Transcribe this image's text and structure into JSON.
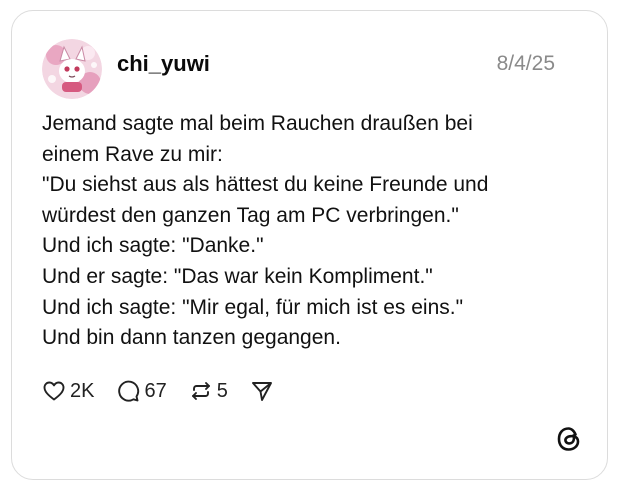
{
  "post": {
    "username": "chi_yuwi",
    "date": "8/4/25",
    "lines": [
      "Jemand sagte mal beim Rauchen draußen bei",
      "einem Rave zu mir:",
      "\"Du siehst aus als hättest du keine Freunde und",
      "würdest den ganzen Tag am PC verbringen.\"",
      "Und ich sagte: \"Danke.\"",
      "Und er sagte: \"Das war kein Kompliment.\"",
      "Und ich sagte: \"Mir egal, für mich ist es eins.\"",
      "Und bin dann tanzen gegangen."
    ],
    "stats": {
      "likes": "2K",
      "replies": "67",
      "reposts": "5"
    }
  },
  "icons": {
    "like": "heart-icon",
    "reply": "comment-bubble-icon",
    "repost": "repost-icon",
    "share": "send-icon",
    "brand": "threads-logo-icon"
  }
}
